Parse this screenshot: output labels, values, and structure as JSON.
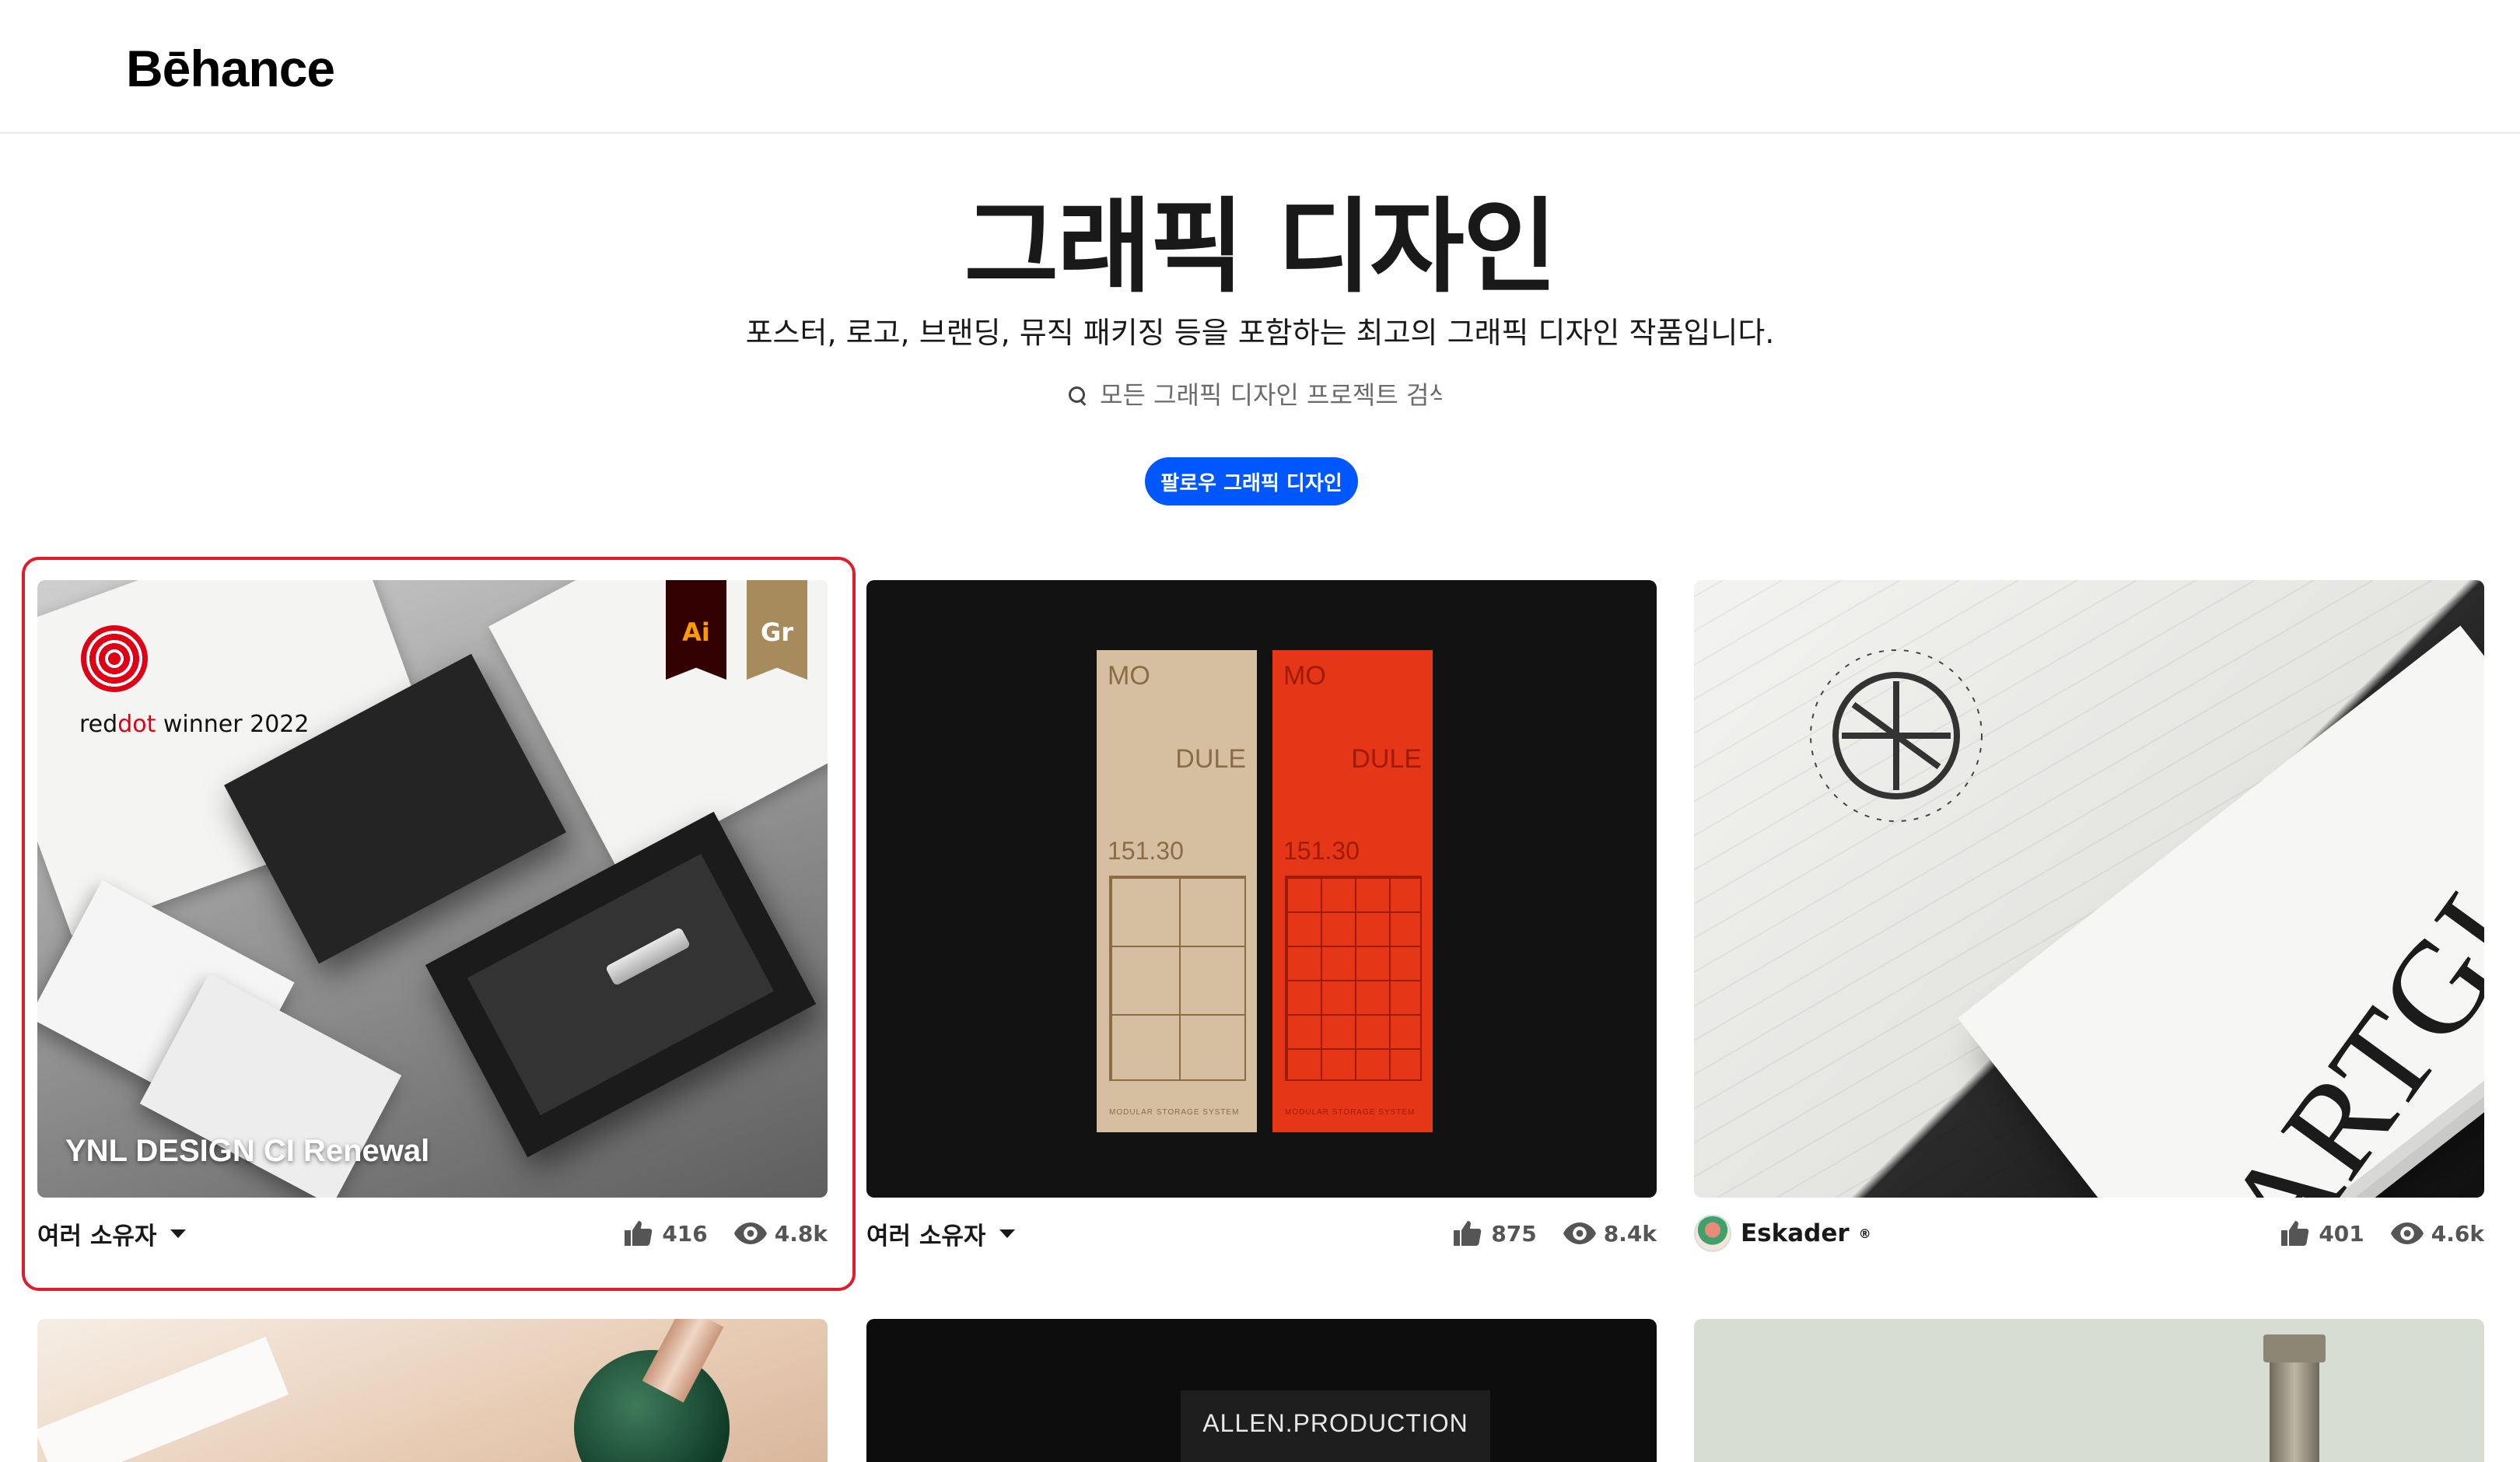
{
  "header": {
    "logo": "Bēhance"
  },
  "hero": {
    "title": "그래픽 디자인",
    "subtitle": "포스터, 로고, 브랜딩, 뮤직 패키징 등을 포함하는 최고의 그래픽 디자인 작품입니다.",
    "search_placeholder": "모든 그래픽 디자인 프로젝트 검색",
    "follow_label": "팔로우 그래픽 디자인"
  },
  "projects": [
    {
      "title": "YNL DESIGN CI Renewal",
      "award": {
        "prefix": "red",
        "highlight": "dot",
        "suffix": " winner 2022"
      },
      "tools": [
        "Ai",
        "Gr"
      ],
      "owner": "여러 소유자",
      "likes": "416",
      "views": "4.8k"
    },
    {
      "panel_lines": [
        "MO",
        "DULE",
        "151.30",
        "MODULAR STORAGE SYSTEM"
      ],
      "owner": "여러 소유자",
      "likes": "875",
      "views": "8.4k"
    },
    {
      "artwork_text": "ARTGLAS",
      "owner": "Eskader",
      "pro_badge": "®",
      "likes": "401",
      "views": "4.6k"
    }
  ],
  "row2": [
    {
      "label": ""
    },
    {
      "label": "ALLEN.PRODUCTION"
    },
    {
      "label": ""
    }
  ],
  "colors": {
    "follow": "#0057ff",
    "selection": "#e21b2b"
  },
  "icons": {
    "like": "thumbs-up-icon",
    "view": "eye-icon",
    "search": "search-icon",
    "menu": "chevron-down-icon"
  }
}
